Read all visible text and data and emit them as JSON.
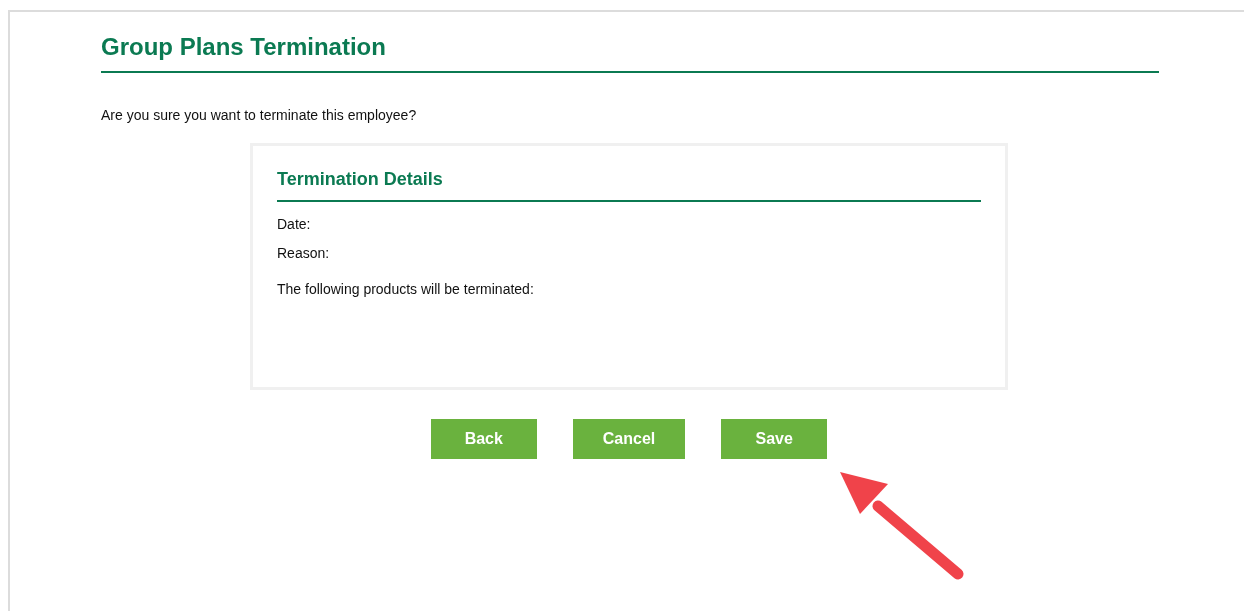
{
  "page": {
    "title": "Group Plans Termination",
    "question": "Are you sure you want to terminate this employee?"
  },
  "details": {
    "title": "Termination Details",
    "fields": [
      {
        "label": "Date:"
      },
      {
        "label": "Reason:"
      }
    ],
    "note": "The following products will be terminated:"
  },
  "buttons": [
    {
      "label": "Back"
    },
    {
      "label": "Cancel"
    },
    {
      "label": "Save"
    }
  ],
  "annotation": {
    "kind": "arrow"
  }
}
